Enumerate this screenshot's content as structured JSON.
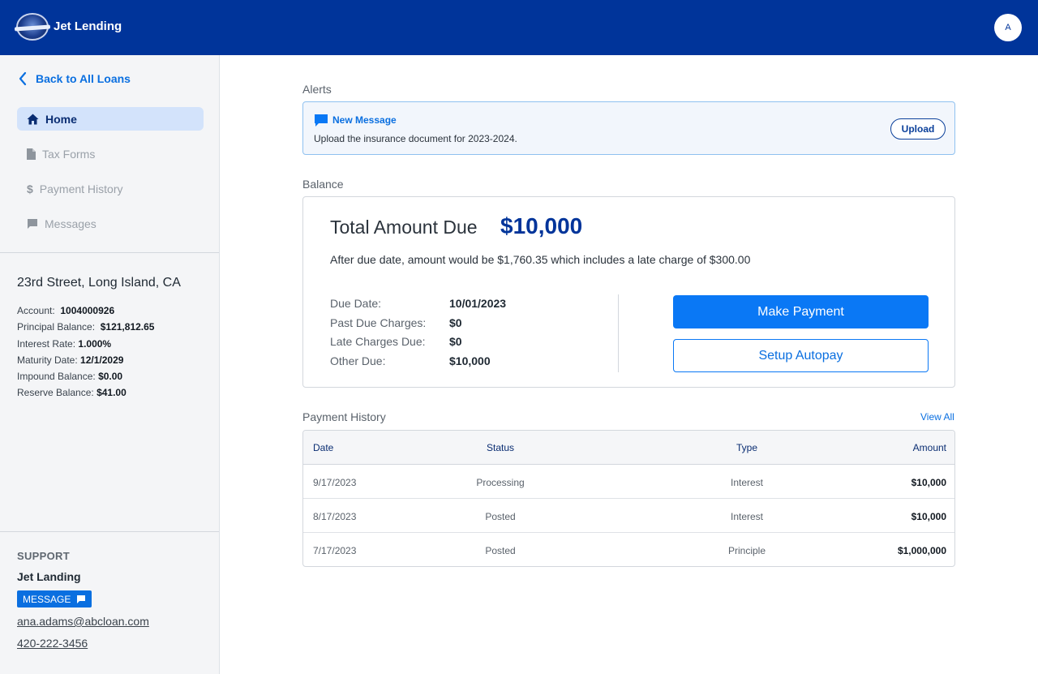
{
  "header": {
    "brand": "Jet Lending",
    "avatar_initial": "A"
  },
  "sidebar": {
    "back_label": "Back to All Loans",
    "nav": [
      {
        "label": "Home",
        "icon": "home-icon",
        "active": true
      },
      {
        "label": "Tax Forms",
        "icon": "document-icon"
      },
      {
        "label": "Payment History",
        "icon": "dollar-icon"
      },
      {
        "label": "Messages",
        "icon": "message-icon"
      }
    ],
    "property": "23rd Street, Long Island, CA",
    "details": [
      {
        "label": "Account:",
        "value": "1004000926"
      },
      {
        "label": "Principal Balance:",
        "value": "$121,812.65"
      },
      {
        "label": "Interest Rate:",
        "value": "1.000%"
      },
      {
        "label": "Maturity Date:",
        "value": "12/1/2029"
      },
      {
        "label": "Impound Balance:",
        "value": "$0.00"
      },
      {
        "label": "Reserve Balance:",
        "value": "$41.00"
      }
    ],
    "support": {
      "label": "SUPPORT",
      "name": "Jet Landing",
      "message_button": "MESSAGE",
      "email": "ana.adams@abcloan.com",
      "phone": "420-222-3456"
    }
  },
  "alerts": {
    "section_label": "Alerts",
    "title": "New Message",
    "text": "Upload the insurance document for 2023-2024.",
    "button": "Upload"
  },
  "balance": {
    "section_label": "Balance",
    "total_label": "Total Amount Due",
    "total_value": "$10,000",
    "late_note": "After due date, amount would be $1,760.35 which includes a late charge of $300.00",
    "rows": [
      {
        "label": "Due Date:",
        "value": "10/01/2023"
      },
      {
        "label": "Past Due Charges:",
        "value": "$0"
      },
      {
        "label": "Late Charges Due:",
        "value": "$0"
      },
      {
        "label": "Other Due:",
        "value": "$10,000"
      }
    ],
    "make_payment": "Make Payment",
    "setup_autopay": "Setup Autopay"
  },
  "payment_history": {
    "section_label": "Payment History",
    "view_all": "View All",
    "columns": [
      "Date",
      "Status",
      "Type",
      "Amount"
    ],
    "rows": [
      [
        "9/17/2023",
        "Processing",
        "Interest",
        "$10,000"
      ],
      [
        "8/17/2023",
        "Posted",
        "Interest",
        "$10,000"
      ],
      [
        "7/17/2023",
        "Posted",
        "Principle",
        "$1,000,000"
      ]
    ]
  },
  "colors": {
    "header": "#00349a",
    "accent": "#0a78f5",
    "link": "#0a6fe0"
  }
}
